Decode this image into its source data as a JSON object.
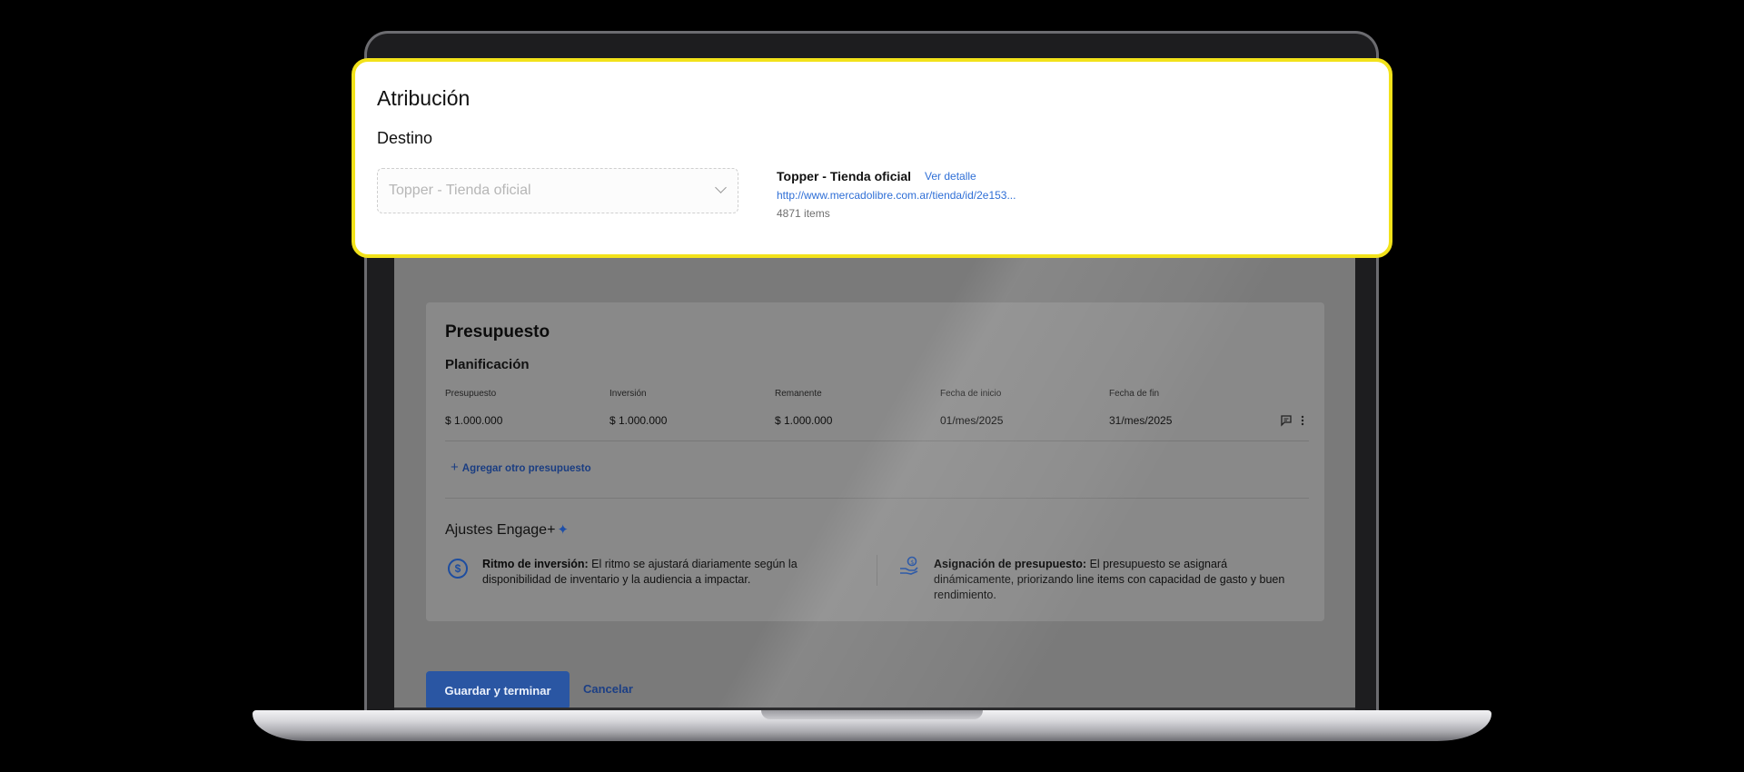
{
  "attribution": {
    "title": "Atribución",
    "destination_label": "Destino",
    "select_value": "Topper - Tienda oficial",
    "store": {
      "name": "Topper - Tienda oficial",
      "detail_link": "Ver detalle",
      "url": "http://www.mercadolibre.com.ar/tienda/id/2e153...",
      "items": "4871 items"
    }
  },
  "budget": {
    "title": "Presupuesto",
    "planning_title": "Planificación",
    "columns": [
      "Presupuesto",
      "Inversión",
      "Remanente",
      "Fecha de inicio",
      "Fecha de fin"
    ],
    "row": [
      "$ 1.000.000",
      "$ 1.000.000",
      "$ 1.000.000",
      "01/mes/2025",
      "31/mes/2025"
    ],
    "row_icons": [
      "comment-icon",
      "more-vertical-icon"
    ],
    "add_link": "Agregar otro presupuesto",
    "engage_title": "Ajustes Engage+",
    "settings": [
      {
        "icon": "dollar-clock-icon",
        "label": "Ritmo de inversión:",
        "text": " El ritmo se ajustará diariamente según la disponibilidad de inventario y la audiencia a impactar."
      },
      {
        "icon": "hand-coin-icon",
        "label": "Asignación de presupuesto:",
        "text": " El presupuesto se asignará dinámicamente, priorizando line items con capacidad de gasto y buen rendimiento."
      }
    ]
  },
  "actions": {
    "save": "Guardar y terminar",
    "cancel": "Cancelar"
  },
  "colors": {
    "highlight_border": "#f2e21a",
    "primary_button": "#2a56a3",
    "link": "#2f6fd6"
  }
}
